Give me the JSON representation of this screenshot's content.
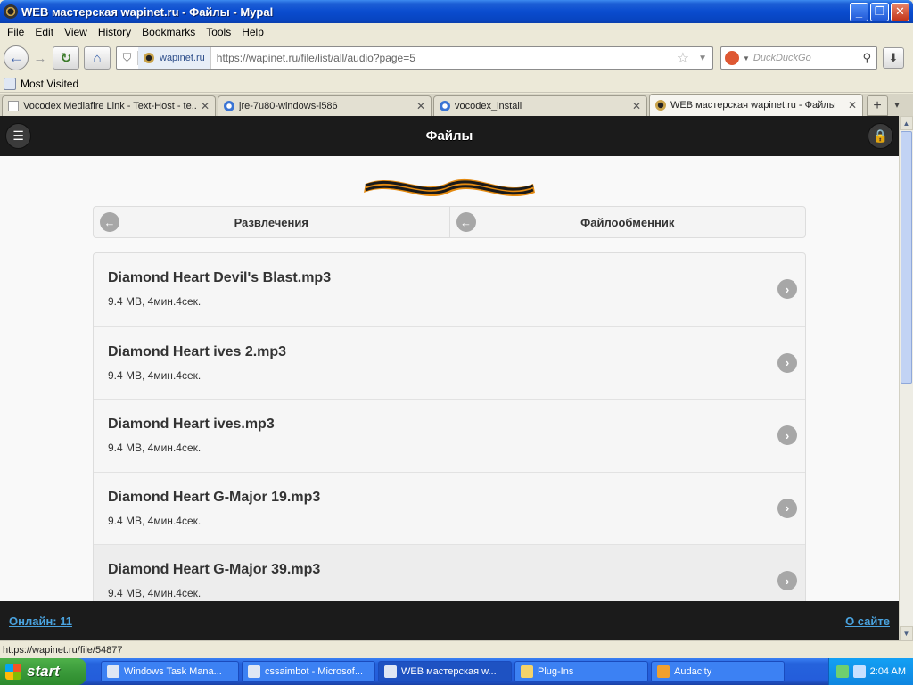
{
  "window": {
    "title": "WEB мастерская wapinet.ru - Файлы - Mypal",
    "minimize": "_",
    "maximize": "❐",
    "close": "✕"
  },
  "menu": [
    "File",
    "Edit",
    "View",
    "History",
    "Bookmarks",
    "Tools",
    "Help"
  ],
  "nav": {
    "back_icon": "arrow-left-icon",
    "forward_icon": "arrow-right-icon",
    "reload_icon": "reload-icon",
    "home_icon": "home-icon",
    "site_identity": "wapinet.ru",
    "url": "https://wapinet.ru/file/list/all/audio?page=5",
    "search_placeholder": "DuckDuckGo"
  },
  "bookmarks": {
    "most_visited": "Most Visited"
  },
  "tabs": [
    {
      "label": "Vocodex Mediafire Link - Text-Host - te...",
      "icon": "page-icon",
      "active": false
    },
    {
      "label": "jre-7u80-windows-i586",
      "icon": "blue-icon",
      "active": false
    },
    {
      "label": "vocodex_install",
      "icon": "blue-icon",
      "active": false
    },
    {
      "label": "WEB мастерская wapinet.ru - Файлы",
      "icon": "wapinet-icon",
      "active": true
    }
  ],
  "page": {
    "header_title": "Файлы",
    "nav_buttons": [
      "Развлечения",
      "Файлообменник"
    ],
    "files": [
      {
        "name": "Diamond Heart Devil's Blast.mp3",
        "meta": "9.4 MB, 4мин.4сек."
      },
      {
        "name": "Diamond Heart ives 2.mp3",
        "meta": "9.4 MB, 4мин.4сек."
      },
      {
        "name": "Diamond Heart ives.mp3",
        "meta": "9.4 MB, 4мин.4сек."
      },
      {
        "name": "Diamond Heart G-Major 19.mp3",
        "meta": "9.4 MB, 4мин.4сек."
      },
      {
        "name": "Diamond Heart G-Major 39.mp3",
        "meta": "9.4 MB, 4мин.4сек."
      }
    ],
    "footer_left": "Онлайн: 11",
    "footer_right": "О сайте",
    "colors": {
      "header_bg": "#1b1b1b",
      "link": "#4aa3df"
    }
  },
  "status": "https://wapinet.ru/file/54877",
  "taskbar": {
    "start": "start",
    "tasks": [
      {
        "label": "Windows Task Mana...",
        "active": false
      },
      {
        "label": "cssaimbot - Microsof...",
        "active": false
      },
      {
        "label": "WEB мастерская w...",
        "active": true
      },
      {
        "label": "Plug-Ins",
        "active": false
      },
      {
        "label": "Audacity",
        "active": false
      }
    ],
    "clock": "2:04 AM"
  }
}
